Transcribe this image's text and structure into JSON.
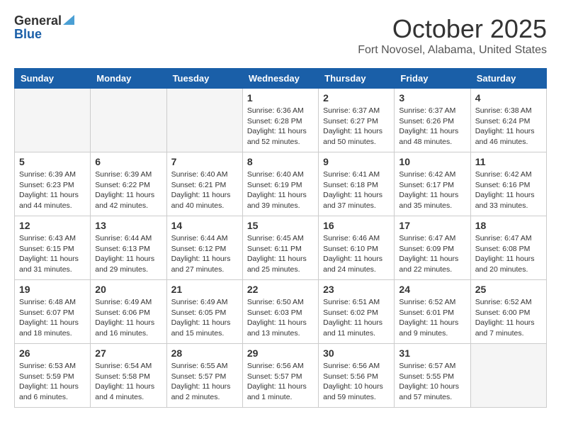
{
  "header": {
    "logo_general": "General",
    "logo_blue": "Blue",
    "month": "October 2025",
    "location": "Fort Novosel, Alabama, United States"
  },
  "days_of_week": [
    "Sunday",
    "Monday",
    "Tuesday",
    "Wednesday",
    "Thursday",
    "Friday",
    "Saturday"
  ],
  "weeks": [
    [
      {
        "day": "",
        "info": ""
      },
      {
        "day": "",
        "info": ""
      },
      {
        "day": "",
        "info": ""
      },
      {
        "day": "1",
        "info": "Sunrise: 6:36 AM\nSunset: 6:28 PM\nDaylight: 11 hours and 52 minutes."
      },
      {
        "day": "2",
        "info": "Sunrise: 6:37 AM\nSunset: 6:27 PM\nDaylight: 11 hours and 50 minutes."
      },
      {
        "day": "3",
        "info": "Sunrise: 6:37 AM\nSunset: 6:26 PM\nDaylight: 11 hours and 48 minutes."
      },
      {
        "day": "4",
        "info": "Sunrise: 6:38 AM\nSunset: 6:24 PM\nDaylight: 11 hours and 46 minutes."
      }
    ],
    [
      {
        "day": "5",
        "info": "Sunrise: 6:39 AM\nSunset: 6:23 PM\nDaylight: 11 hours and 44 minutes."
      },
      {
        "day": "6",
        "info": "Sunrise: 6:39 AM\nSunset: 6:22 PM\nDaylight: 11 hours and 42 minutes."
      },
      {
        "day": "7",
        "info": "Sunrise: 6:40 AM\nSunset: 6:21 PM\nDaylight: 11 hours and 40 minutes."
      },
      {
        "day": "8",
        "info": "Sunrise: 6:40 AM\nSunset: 6:19 PM\nDaylight: 11 hours and 39 minutes."
      },
      {
        "day": "9",
        "info": "Sunrise: 6:41 AM\nSunset: 6:18 PM\nDaylight: 11 hours and 37 minutes."
      },
      {
        "day": "10",
        "info": "Sunrise: 6:42 AM\nSunset: 6:17 PM\nDaylight: 11 hours and 35 minutes."
      },
      {
        "day": "11",
        "info": "Sunrise: 6:42 AM\nSunset: 6:16 PM\nDaylight: 11 hours and 33 minutes."
      }
    ],
    [
      {
        "day": "12",
        "info": "Sunrise: 6:43 AM\nSunset: 6:15 PM\nDaylight: 11 hours and 31 minutes."
      },
      {
        "day": "13",
        "info": "Sunrise: 6:44 AM\nSunset: 6:13 PM\nDaylight: 11 hours and 29 minutes."
      },
      {
        "day": "14",
        "info": "Sunrise: 6:44 AM\nSunset: 6:12 PM\nDaylight: 11 hours and 27 minutes."
      },
      {
        "day": "15",
        "info": "Sunrise: 6:45 AM\nSunset: 6:11 PM\nDaylight: 11 hours and 25 minutes."
      },
      {
        "day": "16",
        "info": "Sunrise: 6:46 AM\nSunset: 6:10 PM\nDaylight: 11 hours and 24 minutes."
      },
      {
        "day": "17",
        "info": "Sunrise: 6:47 AM\nSunset: 6:09 PM\nDaylight: 11 hours and 22 minutes."
      },
      {
        "day": "18",
        "info": "Sunrise: 6:47 AM\nSunset: 6:08 PM\nDaylight: 11 hours and 20 minutes."
      }
    ],
    [
      {
        "day": "19",
        "info": "Sunrise: 6:48 AM\nSunset: 6:07 PM\nDaylight: 11 hours and 18 minutes."
      },
      {
        "day": "20",
        "info": "Sunrise: 6:49 AM\nSunset: 6:06 PM\nDaylight: 11 hours and 16 minutes."
      },
      {
        "day": "21",
        "info": "Sunrise: 6:49 AM\nSunset: 6:05 PM\nDaylight: 11 hours and 15 minutes."
      },
      {
        "day": "22",
        "info": "Sunrise: 6:50 AM\nSunset: 6:03 PM\nDaylight: 11 hours and 13 minutes."
      },
      {
        "day": "23",
        "info": "Sunrise: 6:51 AM\nSunset: 6:02 PM\nDaylight: 11 hours and 11 minutes."
      },
      {
        "day": "24",
        "info": "Sunrise: 6:52 AM\nSunset: 6:01 PM\nDaylight: 11 hours and 9 minutes."
      },
      {
        "day": "25",
        "info": "Sunrise: 6:52 AM\nSunset: 6:00 PM\nDaylight: 11 hours and 7 minutes."
      }
    ],
    [
      {
        "day": "26",
        "info": "Sunrise: 6:53 AM\nSunset: 5:59 PM\nDaylight: 11 hours and 6 minutes."
      },
      {
        "day": "27",
        "info": "Sunrise: 6:54 AM\nSunset: 5:58 PM\nDaylight: 11 hours and 4 minutes."
      },
      {
        "day": "28",
        "info": "Sunrise: 6:55 AM\nSunset: 5:57 PM\nDaylight: 11 hours and 2 minutes."
      },
      {
        "day": "29",
        "info": "Sunrise: 6:56 AM\nSunset: 5:57 PM\nDaylight: 11 hours and 1 minute."
      },
      {
        "day": "30",
        "info": "Sunrise: 6:56 AM\nSunset: 5:56 PM\nDaylight: 10 hours and 59 minutes."
      },
      {
        "day": "31",
        "info": "Sunrise: 6:57 AM\nSunset: 5:55 PM\nDaylight: 10 hours and 57 minutes."
      },
      {
        "day": "",
        "info": ""
      }
    ]
  ]
}
